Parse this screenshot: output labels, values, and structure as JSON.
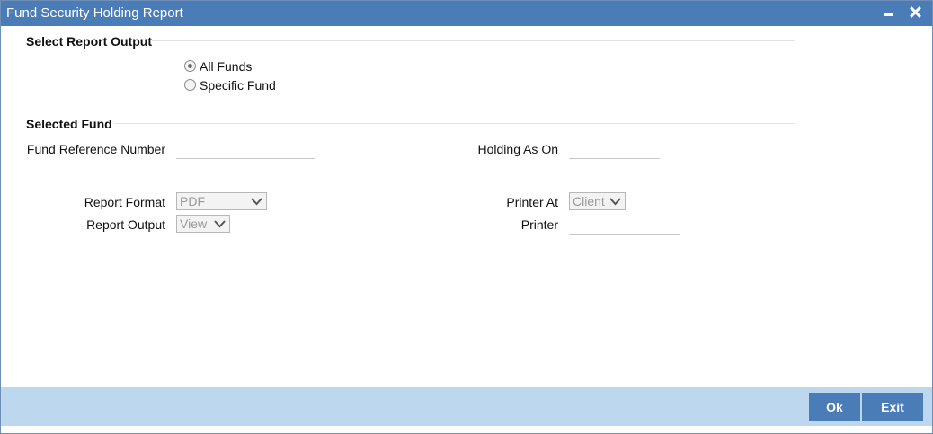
{
  "window": {
    "title": "Fund Security Holding Report"
  },
  "report_output_section": {
    "title": "Select Report Output",
    "options": [
      {
        "label": "All Funds",
        "checked": true
      },
      {
        "label": "Specific Fund",
        "checked": false
      }
    ]
  },
  "selected_fund_section": {
    "title": "Selected Fund",
    "fund_reference_label": "Fund Reference Number",
    "fund_reference_value": "",
    "holding_as_on_label": "Holding As On",
    "holding_as_on_value": ""
  },
  "report_settings": {
    "report_format_label": "Report Format",
    "report_format_value": "PDF",
    "report_output_label": "Report Output",
    "report_output_value": "View",
    "printer_at_label": "Printer At",
    "printer_at_value": "Client",
    "printer_label": "Printer",
    "printer_value": ""
  },
  "footer": {
    "ok_label": "Ok",
    "exit_label": "Exit"
  },
  "colors": {
    "titlebar": "#4a7cb8",
    "footer": "#bcd7ee",
    "button": "#4a7cb8"
  }
}
